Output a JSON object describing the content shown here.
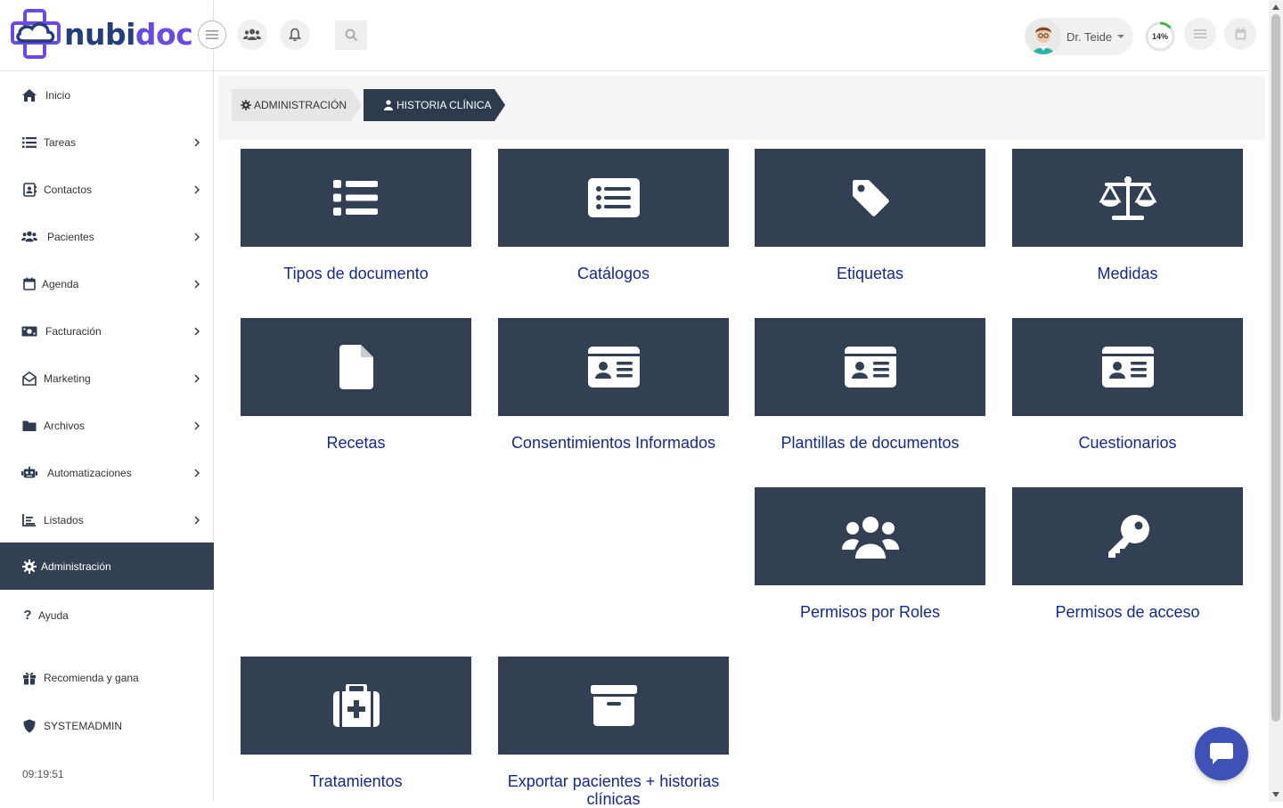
{
  "brand": {
    "name_part1": "nubi",
    "name_part2": "doc",
    "color_primary": "#253d78",
    "color_accent": "#6a4ae0"
  },
  "topbar": {
    "user_name": "Dr. Teide",
    "progress_label": "14%",
    "progress_value": 0.14
  },
  "sidebar": {
    "items": [
      {
        "label": "Inicio",
        "icon": "home-icon",
        "has_chevron": false
      },
      {
        "label": "Tareas",
        "icon": "list-icon",
        "has_chevron": true
      },
      {
        "label": "Contactos",
        "icon": "address-book-icon",
        "has_chevron": true
      },
      {
        "label": "Pacientes",
        "icon": "users-icon",
        "has_chevron": true
      },
      {
        "label": "Agenda",
        "icon": "calendar-icon",
        "has_chevron": true
      },
      {
        "label": "Facturación",
        "icon": "money-bill-icon",
        "has_chevron": true
      },
      {
        "label": "Marketing",
        "icon": "envelope-open-icon",
        "has_chevron": true
      },
      {
        "label": "Archivos",
        "icon": "folder-icon",
        "has_chevron": true
      },
      {
        "label": "Automatizaciones",
        "icon": "robot-icon",
        "has_chevron": true
      },
      {
        "label": "Listados",
        "icon": "chart-area-icon",
        "has_chevron": true
      },
      {
        "label": "Administración",
        "icon": "gear-icon",
        "has_chevron": false,
        "active": true
      },
      {
        "label": "Ayuda",
        "icon": "question-icon",
        "has_chevron": false
      },
      {
        "label": "Recomienda y gana",
        "icon": "gift-icon",
        "has_chevron": false
      },
      {
        "label": "SYSTEMADMIN",
        "icon": "shield-icon",
        "has_chevron": false
      }
    ],
    "clock": "09:19:51",
    "active_color": "#333f52"
  },
  "breadcrumb": {
    "items": [
      {
        "label": "ADMINISTRACIÓN",
        "icon": "gear-icon"
      },
      {
        "label": "HISTORIA CLÍNICA",
        "icon": "user-doctor-icon"
      }
    ]
  },
  "cards": [
    {
      "label": "Tipos de documento",
      "icon": "list-ul-icon"
    },
    {
      "label": "Catálogos",
      "icon": "rectangle-list-icon"
    },
    {
      "label": "Etiquetas",
      "icon": "tag-icon"
    },
    {
      "label": "Medidas",
      "icon": "scale-balanced-icon"
    },
    {
      "label": "Recetas",
      "icon": "file-icon"
    },
    {
      "label": "Consentimientos Informados",
      "icon": "id-card-icon"
    },
    {
      "label": "Plantillas de documentos",
      "icon": "id-card-icon"
    },
    {
      "label": "Cuestionarios",
      "icon": "id-card-icon"
    },
    {
      "label": "Permisos por Roles",
      "icon": "users-icon"
    },
    {
      "label": "Permisos de acceso",
      "icon": "key-icon"
    },
    {
      "label": "Tratamientos",
      "icon": "suitcase-medical-icon"
    },
    {
      "label": "Exportar pacientes + historias clínicas",
      "icon": "box-archive-icon"
    }
  ],
  "colors": {
    "card_bg": "#333f52",
    "card_label": "#162a85",
    "chat_button": "#3f51b5"
  }
}
